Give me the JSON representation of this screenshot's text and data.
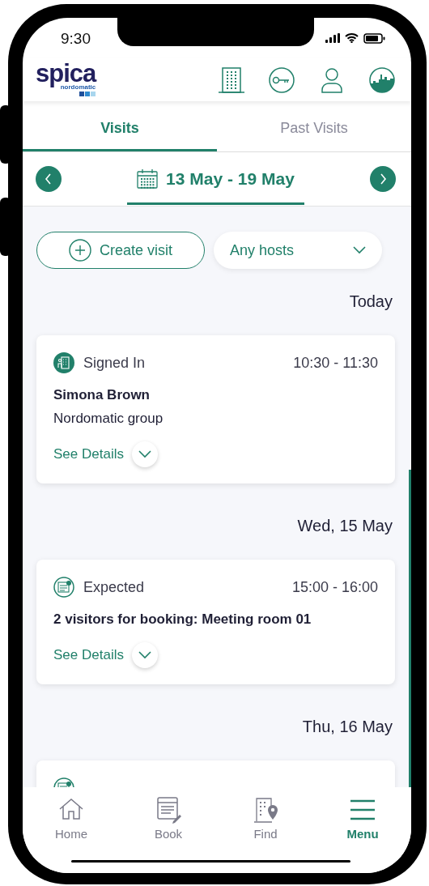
{
  "status_bar": {
    "time": "9:30"
  },
  "header": {
    "logo": {
      "name": "spica",
      "subtitle": "nordomatic"
    }
  },
  "tabs": [
    {
      "label": "Visits",
      "selected": true
    },
    {
      "label": "Past Visits",
      "selected": false
    }
  ],
  "week": {
    "range": "13 May - 19 May"
  },
  "actions": {
    "create": "Create visit",
    "host_filter": "Any hosts"
  },
  "days": [
    {
      "label": "Today",
      "visits": [
        {
          "kind": "signed_in",
          "status": "Signed In",
          "time": "10:30 - 11:30",
          "title": "Simona Brown",
          "subtitle": "Nordomatic group",
          "details": "See Details"
        }
      ]
    },
    {
      "label": "Wed, 15 May",
      "visits": [
        {
          "kind": "expected",
          "status": "Expected",
          "time": "15:00 - 16:00",
          "title": "2 visitors for booking: Meeting room 01",
          "details": "See Details"
        }
      ]
    },
    {
      "label": "Thu, 16 May",
      "visits": [
        {
          "kind": "expected"
        }
      ]
    }
  ],
  "nav": [
    {
      "label": "Home",
      "selected": false
    },
    {
      "label": "Book",
      "selected": false
    },
    {
      "label": "Find",
      "selected": false
    },
    {
      "label": "Menu",
      "selected": true
    }
  ]
}
